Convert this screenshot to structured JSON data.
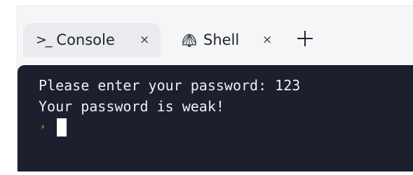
{
  "tabs": [
    {
      "label": "Console",
      "close": "×",
      "active": true,
      "icon": "terminal-prompt-icon",
      "icon_glyph": ">_"
    },
    {
      "label": "Shell",
      "close": "×",
      "active": false,
      "icon": "shell-icon"
    }
  ],
  "add_tab_icon": "plus-icon",
  "terminal": {
    "lines": [
      "Please enter your password: 123",
      "Your password is weak!"
    ],
    "prompt_symbol": "›",
    "prompt_color": "#c9a227",
    "background": "#1b1f2e",
    "text_color": "#eef0f4"
  }
}
